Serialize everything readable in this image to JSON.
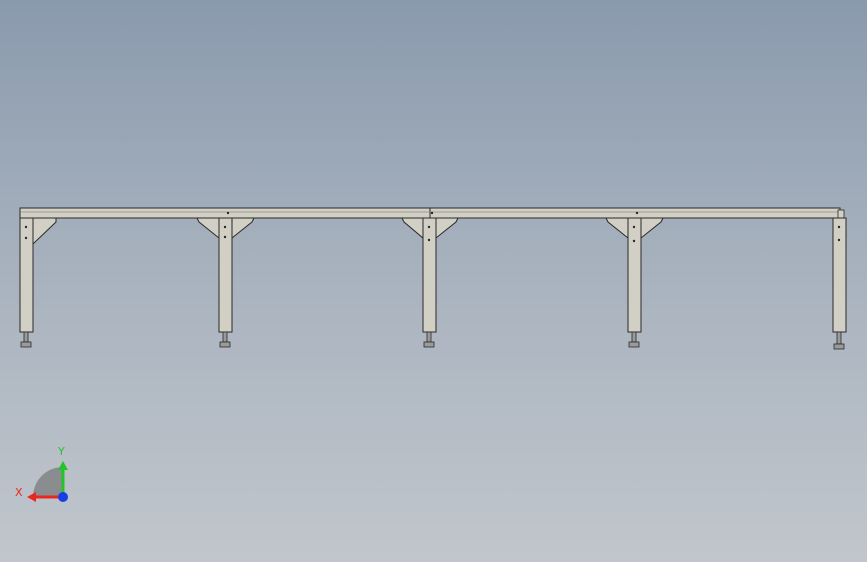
{
  "scene": {
    "model": "steel-frame-assembly",
    "view": "front",
    "colors": {
      "background_top": "#8a9aad",
      "background_bottom": "#c1c6cc",
      "steel_fill": "#d2cfc5",
      "steel_edge": "#2a2a2a",
      "foot_fill": "#9a9a9a"
    },
    "legs": 5,
    "braced_legs": 4
  },
  "triad": {
    "x_label": "X",
    "y_label": "Y",
    "x_color": "#e8281e",
    "y_color": "#22c42a",
    "z_color": "#1a3ee6"
  }
}
